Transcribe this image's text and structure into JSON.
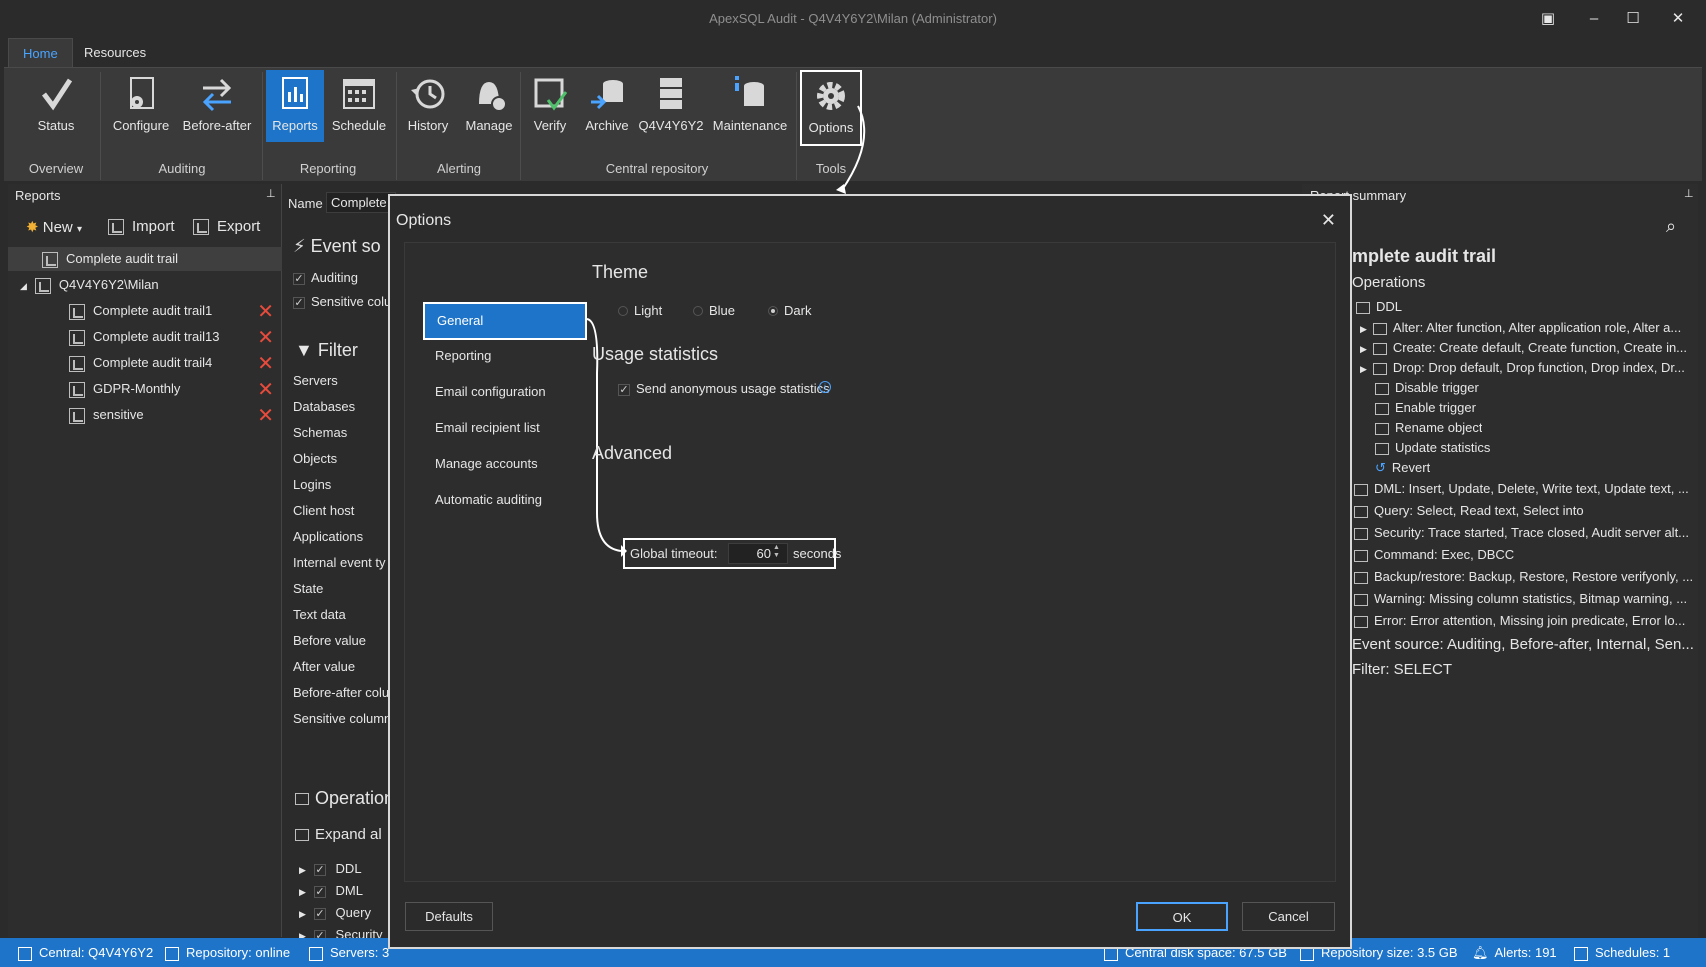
{
  "window": {
    "title": "ApexSQL Audit - Q4V4Y6Y2\\Milan (Administrator)",
    "restore_label": "▣",
    "minimize_label": "–",
    "maximize_label": "☐",
    "close_label": "✕"
  },
  "ribbon": {
    "tabs": [
      "Home",
      "Resources"
    ],
    "buttons": {
      "status": "Status",
      "configure": "Configure",
      "before_after": "Before-after",
      "reports": "Reports",
      "schedule": "Schedule",
      "history": "History",
      "manage": "Manage",
      "verify": "Verify",
      "archive": "Archive",
      "server": "Q4V4Y6Y2",
      "maintenance": "Maintenance",
      "options": "Options"
    },
    "groups": {
      "overview": "Overview",
      "auditing": "Auditing",
      "reporting": "Reporting",
      "alerting": "Alerting",
      "central_repository": "Central repository",
      "tools": "Tools"
    }
  },
  "left_panel": {
    "title": "Reports",
    "new_label": "New",
    "import_label": "Import",
    "export_label": "Export",
    "items": {
      "top": "Complete audit trail",
      "server": "Q4V4Y6Y2\\Milan",
      "children": [
        "Complete audit trail1",
        "Complete audit trail13",
        "Complete audit trail4",
        "GDPR-Monthly",
        "sensitive"
      ]
    }
  },
  "mid_panel": {
    "name_label": "Name",
    "name_value": "Complete",
    "event_source_title": "Event so",
    "auditing": "Auditing",
    "sensitive": "Sensitive colu",
    "filter_title": "Filter",
    "filters": [
      "Servers",
      "Databases",
      "Schemas",
      "Objects",
      "Logins",
      "Client host",
      "Applications",
      "Internal event ty",
      "State",
      "Text data",
      "Before value",
      "After value",
      "Before-after colu",
      "Sensitive column"
    ],
    "operations_title": "Operation",
    "expand_all": "Expand al",
    "ops": [
      "DDL",
      "DML",
      "Query",
      "Security"
    ]
  },
  "right_panel": {
    "title": "Report summary",
    "heading": "mplete audit trail",
    "operations": "Operations",
    "ddl": "DDL",
    "ddl_items": [
      "Alter: Alter function, Alter application role, Alter a...",
      "Create: Create default, Create function, Create in...",
      "Drop: Drop default, Drop function, Drop index, Dr...",
      "Disable trigger",
      "Enable trigger",
      "Rename object",
      "Update statistics",
      "Revert"
    ],
    "other_ops": [
      "DML: Insert, Update, Delete, Write text, Update text, ...",
      "Query: Select, Read text, Select into",
      "Security: Trace started, Trace closed, Audit server alt...",
      "Command: Exec, DBCC",
      "Backup/restore: Backup, Restore, Restore verifyonly, ...",
      "Warning: Missing column statistics, Bitmap warning, ...",
      "Error: Error attention, Missing join predicate, Error lo..."
    ],
    "event_source": "Event source: Auditing, Before-after, Internal, Sen...",
    "filter": "Filter: SELECT"
  },
  "dialog": {
    "title": "Options",
    "nav": [
      "General",
      "Reporting",
      "Email configuration",
      "Email recipient list",
      "Manage accounts",
      "Automatic auditing"
    ],
    "theme_title": "Theme",
    "theme_options": [
      "Light",
      "Blue",
      "Dark"
    ],
    "theme_selected": "Dark",
    "usage_title": "Usage statistics",
    "usage_checkbox": "Send anonymous usage statistics",
    "advanced_title": "Advanced",
    "timeout_label": "Global timeout:",
    "timeout_value": "60",
    "timeout_unit": "seconds",
    "defaults_label": "Defaults",
    "ok_label": "OK",
    "cancel_label": "Cancel"
  },
  "status_bar": {
    "central": "Central: Q4V4Y6Y2",
    "repository": "Repository: online",
    "servers": "Servers: 3",
    "disk": "Central disk space: 67.5 GB",
    "repo_size": "Repository size: 3.5 GB",
    "alerts": "Alerts: 191",
    "schedules": "Schedules: 1"
  },
  "colors": {
    "accent": "#1e74c8",
    "background": "#2b2b2b",
    "delete": "#e84b3c"
  }
}
